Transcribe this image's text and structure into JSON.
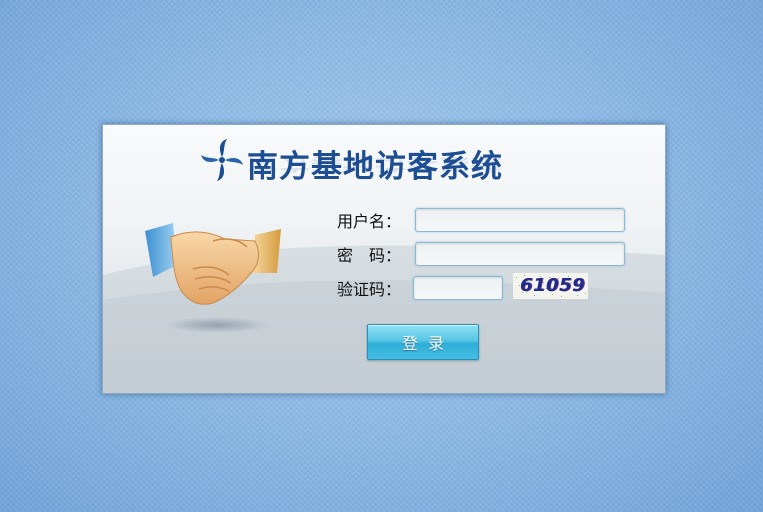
{
  "app": {
    "title": "南方基地访客系统"
  },
  "form": {
    "username_label": "用户名：",
    "username_value": "",
    "password_label": "密　码：",
    "password_value": "",
    "captcha_label": "验证码：",
    "captcha_value": "",
    "captcha_code": "61059"
  },
  "buttons": {
    "login_label": "登录"
  },
  "icons": {
    "logo": "pinwheel-logo-icon",
    "illustration": "handshake-icon"
  },
  "colors": {
    "title": "#1d4d92",
    "background": "#8dbbe7",
    "button": "#46bde2",
    "field_border": "#8fb9d3"
  }
}
